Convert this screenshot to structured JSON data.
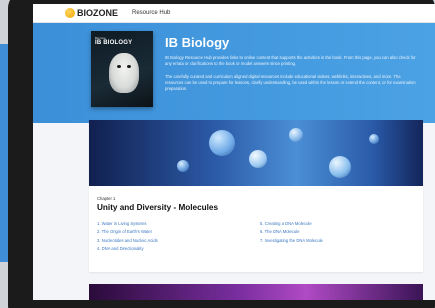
{
  "header": {
    "logo_text": "BIOZONE",
    "title": "Resource Hub"
  },
  "hero": {
    "book_publisher": "Biozone",
    "book_title": "IB BIOLOGY",
    "title": "IB Biology",
    "paragraph_1": "IB Biology Resource Hub provides links to online content that supports the activities in the book. From this page, you can also check for any errata or clarifications to the book or model answers since printing.",
    "paragraph_2": "The carefully curated and curriculum aligned digital resources include educational videos, weblinks, interactives, and more. The resources can be used to prepare for lessons, clarify understanding, be used within the lesson or extend the content, or for examination preparation."
  },
  "chapter": {
    "kicker": "Chapter 1",
    "title": "Unity and Diversity - Molecules",
    "topics_left": [
      "1. Water in Living Systems",
      "2. The Origin of Earth's Water",
      "3. Nucleotides and Nucleic Acids",
      "4. DNA and Directionality"
    ],
    "topics_right": [
      "5. Creating a DNA Molecule",
      "6. The DNA Molecule",
      "7. Investigating the DNA Molecule"
    ]
  },
  "colors": {
    "hero_blue": "#3b8fd8",
    "link_blue": "#3b78c2",
    "side_panel_blue": "#3f8dd6"
  }
}
